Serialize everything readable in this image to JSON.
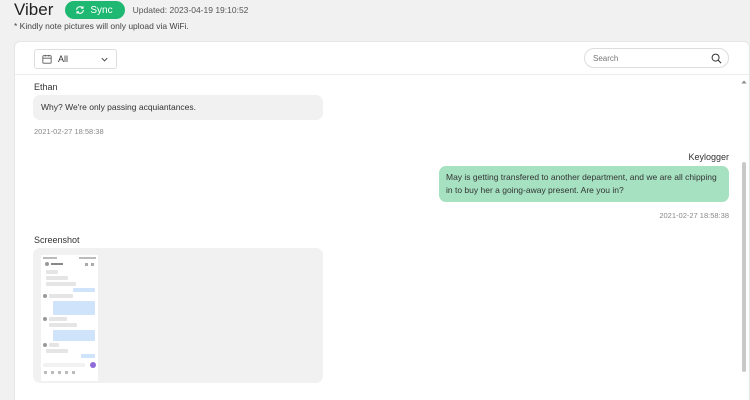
{
  "header": {
    "app_title": "Viber",
    "sync_label": "Sync",
    "updated_text": "Updated: 2023-04-19 19:10:52",
    "note": "* Kindly note pictures will only upload via WiFi."
  },
  "toolbar": {
    "filter_value": "All",
    "search_placeholder": "Search"
  },
  "messages": [
    {
      "sender": "Ethan",
      "text": "Why? We're only passing acquiantances.",
      "time": "2021-02-27 18:58:38",
      "direction": "incoming"
    },
    {
      "sender": "Keylogger",
      "text": "May is getting transfered to another department, and we are all chipping in to buy her a going-away present. Are you in?",
      "time": "2021-02-27 18:58:38",
      "direction": "outgoing"
    },
    {
      "sender": "Screenshot",
      "type": "image",
      "direction": "incoming"
    }
  ],
  "colors": {
    "accent": "#1fb872",
    "outgoing_bubble": "#a6e2c2",
    "incoming_bubble": "#f1f1f1"
  }
}
